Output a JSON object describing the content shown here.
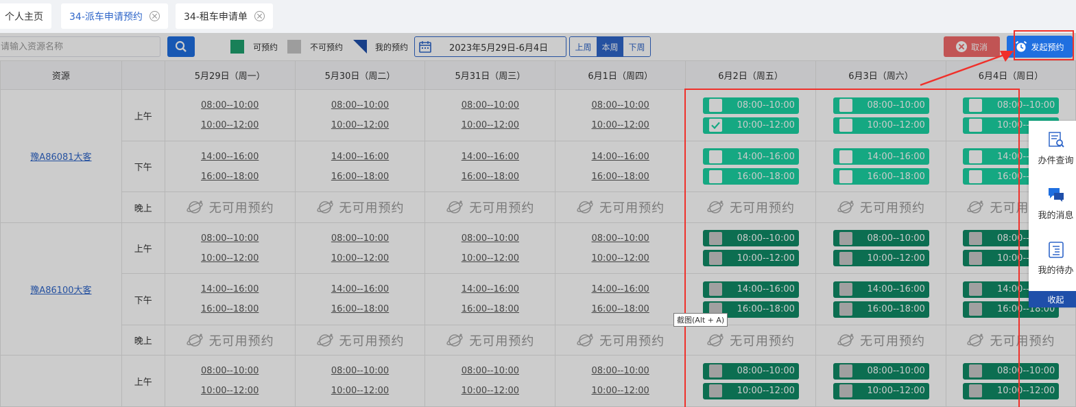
{
  "tabs": [
    {
      "label": "个人主页",
      "closable": false
    },
    {
      "label": "34-派车申请预约",
      "closable": true,
      "active": true
    },
    {
      "label": "34-租车申请单",
      "closable": true
    }
  ],
  "toolbar": {
    "search_placeholder": "请输入资源名称",
    "legend": {
      "available": "可预约",
      "unavailable": "不可预约",
      "mine": "我的预约"
    },
    "date_range": "2023年5月29日-6月4日",
    "week_buttons": [
      "上周",
      "本周",
      "下周"
    ],
    "cancel_label": "取消",
    "start_label": "发起预约"
  },
  "grid": {
    "resource_header": "资源",
    "days": [
      "5月29日（周一）",
      "5月30日（周二）",
      "5月31日（周三）",
      "6月1日（周四）",
      "6月2日（周五）",
      "6月3日（周六）",
      "6月4日（周日）"
    ],
    "periods": {
      "am": "上午",
      "pm": "下午",
      "eve": "晚上"
    },
    "am_slots": [
      "08:00--10:00",
      "10:00--12:00"
    ],
    "pm_slots": [
      "14:00--16:00",
      "16:00--18:00"
    ],
    "no_booking": "无可用预约",
    "resources": [
      {
        "name": "豫A86081大客"
      },
      {
        "name": "豫A86100大客"
      }
    ]
  },
  "side_panel": {
    "items": [
      {
        "label": "办件查询",
        "icon": "search-doc-icon"
      },
      {
        "label": "我的消息",
        "icon": "chat-icon"
      },
      {
        "label": "我的待办",
        "icon": "todo-icon"
      }
    ],
    "collapse_label": "收起"
  },
  "tooltip": "截图(Alt + A)",
  "colors": {
    "available": "#1bd3a3",
    "booked": "#0f8a66",
    "primary": "#1f6fe0",
    "cancel": "#f26a6a",
    "highlight": "#f0302a"
  }
}
